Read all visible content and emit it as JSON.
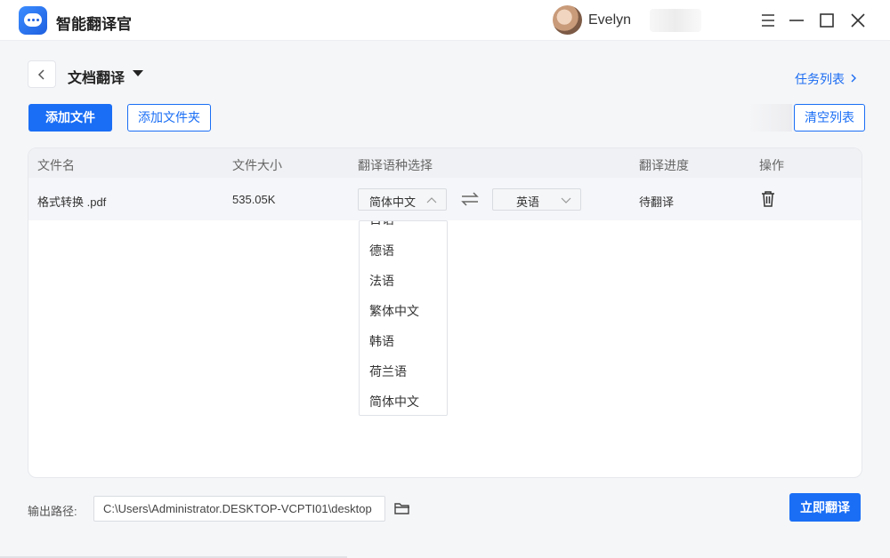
{
  "app": {
    "name": "智能翻译官",
    "user": "Evelyn"
  },
  "header": {
    "title": "文档翻译",
    "task_list": "任务列表"
  },
  "toolbar": {
    "add_file": "添加文件",
    "add_folder": "添加文件夹",
    "clear_list": "清空列表"
  },
  "table": {
    "headers": [
      "文件名",
      "文件大小",
      "翻译语种选择",
      "翻译进度",
      "操作"
    ],
    "rows": [
      {
        "file_name": "格式转换 .pdf",
        "size": "535.05K",
        "source_lang": "简体中文",
        "target_lang": "英语",
        "status": "待翻译"
      }
    ]
  },
  "dropdown": {
    "options": [
      "日语",
      "德语",
      "法语",
      "繁体中文",
      "韩语",
      "荷兰语",
      "简体中文"
    ]
  },
  "footer": {
    "output_label": "输出路径:",
    "output_path": "C:\\Users\\Administrator.DESKTOP-VCPTI01\\desktop",
    "translate_now": "立即翻译"
  },
  "colors": {
    "accent": "#1a6ef5",
    "header_bg": "#f0f1f4",
    "page_bg": "#f5f6f8"
  },
  "icons": [
    "app-logo-icon",
    "chevron-left-icon",
    "caret-down-icon",
    "chevron-right-icon",
    "chevron-up-icon",
    "chevron-down-icon",
    "swap-icon",
    "trash-icon",
    "folder-icon",
    "minimize-icon",
    "restore-icon",
    "maximize-icon",
    "close-icon"
  ]
}
